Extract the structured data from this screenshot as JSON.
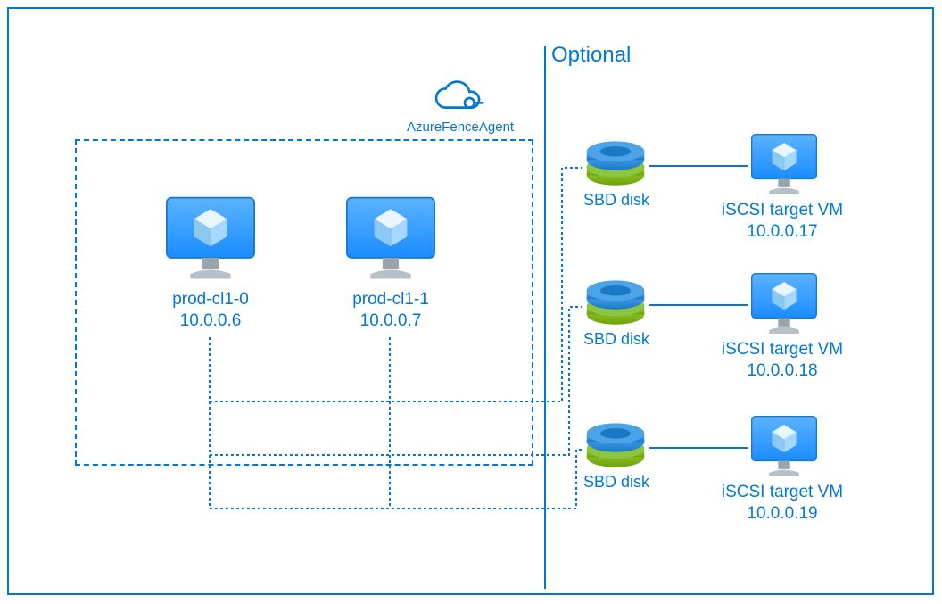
{
  "optional_label": "Optional",
  "azure_fence": "AzureFenceAgent",
  "cluster_nodes": [
    {
      "name": "prod-cl1-0",
      "ip": "10.0.0.6"
    },
    {
      "name": "prod-cl1-1",
      "ip": "10.0.0.7"
    }
  ],
  "sbd_disk_label": "SBD disk",
  "iscsi_targets": [
    {
      "label_line1": "iSCSI target VM",
      "ip": "10.0.0.17"
    },
    {
      "label_line1": "iSCSI target VM",
      "ip": "10.0.0.18"
    },
    {
      "label_line1": "iSCSI target VM",
      "ip": "10.0.0.19"
    }
  ],
  "colors": {
    "primary": "#0078d4",
    "accent_green": "#7fba00"
  }
}
